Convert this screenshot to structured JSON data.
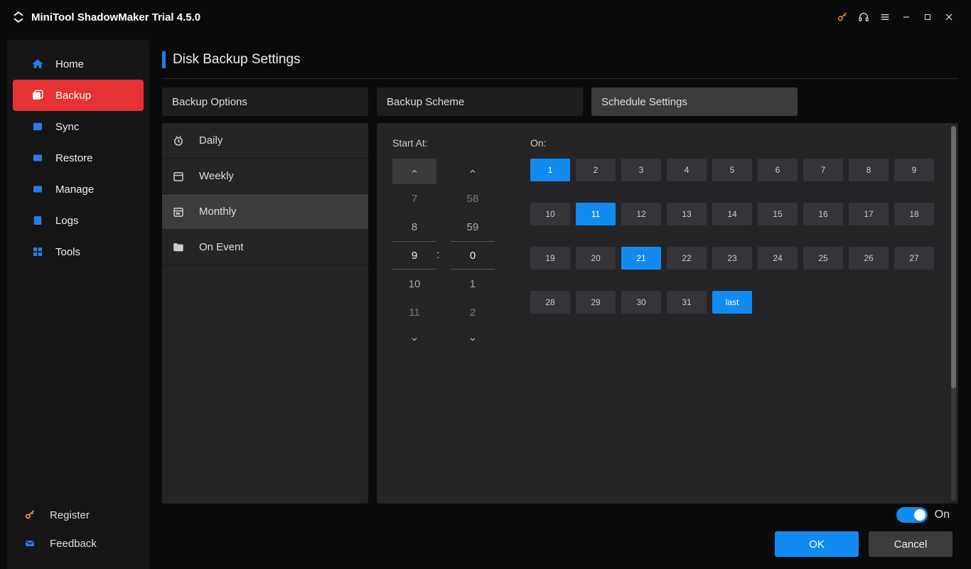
{
  "app": {
    "title": "MiniTool ShadowMaker Trial 4.5.0"
  },
  "sidebar": {
    "items": [
      {
        "label": "Home"
      },
      {
        "label": "Backup"
      },
      {
        "label": "Sync"
      },
      {
        "label": "Restore"
      },
      {
        "label": "Manage"
      },
      {
        "label": "Logs"
      },
      {
        "label": "Tools"
      }
    ],
    "register": "Register",
    "feedback": "Feedback"
  },
  "page": {
    "title": "Disk Backup Settings"
  },
  "tabs": [
    {
      "label": "Backup Options"
    },
    {
      "label": "Backup Scheme"
    },
    {
      "label": "Schedule Settings"
    }
  ],
  "periods": [
    {
      "label": "Daily"
    },
    {
      "label": "Weekly"
    },
    {
      "label": "Monthly"
    },
    {
      "label": "On Event"
    }
  ],
  "schedule": {
    "start_label": "Start At:",
    "on_label": "On:",
    "hours": [
      "7",
      "8",
      "9",
      "10",
      "11"
    ],
    "minutes": [
      "58",
      "59",
      "0",
      "1",
      "2"
    ],
    "colon": ":",
    "days": [
      "1",
      "2",
      "3",
      "4",
      "5",
      "6",
      "7",
      "8",
      "9",
      "10",
      "11",
      "12",
      "13",
      "14",
      "15",
      "16",
      "17",
      "18",
      "19",
      "20",
      "21",
      "22",
      "23",
      "24",
      "25",
      "26",
      "27",
      "28",
      "29",
      "30",
      "31",
      "last"
    ],
    "selected_days": [
      "1",
      "11",
      "21",
      "last"
    ]
  },
  "footer": {
    "toggle_label": "On",
    "ok": "OK",
    "cancel": "Cancel"
  }
}
